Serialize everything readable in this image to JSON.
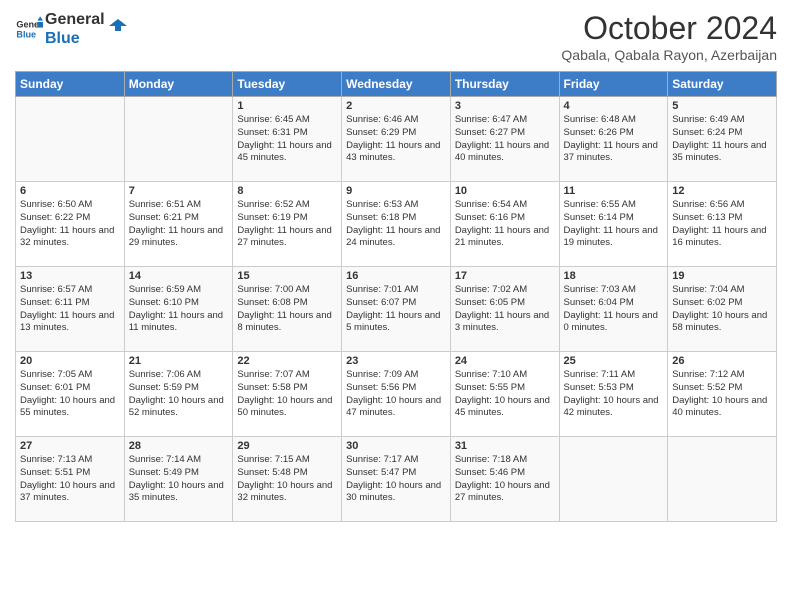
{
  "header": {
    "logo_general": "General",
    "logo_blue": "Blue",
    "month": "October 2024",
    "location": "Qabala, Qabala Rayon, Azerbaijan"
  },
  "days_of_week": [
    "Sunday",
    "Monday",
    "Tuesday",
    "Wednesday",
    "Thursday",
    "Friday",
    "Saturday"
  ],
  "weeks": [
    [
      {
        "day": "",
        "content": ""
      },
      {
        "day": "",
        "content": ""
      },
      {
        "day": "1",
        "content": "Sunrise: 6:45 AM\nSunset: 6:31 PM\nDaylight: 11 hours and 45 minutes."
      },
      {
        "day": "2",
        "content": "Sunrise: 6:46 AM\nSunset: 6:29 PM\nDaylight: 11 hours and 43 minutes."
      },
      {
        "day": "3",
        "content": "Sunrise: 6:47 AM\nSunset: 6:27 PM\nDaylight: 11 hours and 40 minutes."
      },
      {
        "day": "4",
        "content": "Sunrise: 6:48 AM\nSunset: 6:26 PM\nDaylight: 11 hours and 37 minutes."
      },
      {
        "day": "5",
        "content": "Sunrise: 6:49 AM\nSunset: 6:24 PM\nDaylight: 11 hours and 35 minutes."
      }
    ],
    [
      {
        "day": "6",
        "content": "Sunrise: 6:50 AM\nSunset: 6:22 PM\nDaylight: 11 hours and 32 minutes."
      },
      {
        "day": "7",
        "content": "Sunrise: 6:51 AM\nSunset: 6:21 PM\nDaylight: 11 hours and 29 minutes."
      },
      {
        "day": "8",
        "content": "Sunrise: 6:52 AM\nSunset: 6:19 PM\nDaylight: 11 hours and 27 minutes."
      },
      {
        "day": "9",
        "content": "Sunrise: 6:53 AM\nSunset: 6:18 PM\nDaylight: 11 hours and 24 minutes."
      },
      {
        "day": "10",
        "content": "Sunrise: 6:54 AM\nSunset: 6:16 PM\nDaylight: 11 hours and 21 minutes."
      },
      {
        "day": "11",
        "content": "Sunrise: 6:55 AM\nSunset: 6:14 PM\nDaylight: 11 hours and 19 minutes."
      },
      {
        "day": "12",
        "content": "Sunrise: 6:56 AM\nSunset: 6:13 PM\nDaylight: 11 hours and 16 minutes."
      }
    ],
    [
      {
        "day": "13",
        "content": "Sunrise: 6:57 AM\nSunset: 6:11 PM\nDaylight: 11 hours and 13 minutes."
      },
      {
        "day": "14",
        "content": "Sunrise: 6:59 AM\nSunset: 6:10 PM\nDaylight: 11 hours and 11 minutes."
      },
      {
        "day": "15",
        "content": "Sunrise: 7:00 AM\nSunset: 6:08 PM\nDaylight: 11 hours and 8 minutes."
      },
      {
        "day": "16",
        "content": "Sunrise: 7:01 AM\nSunset: 6:07 PM\nDaylight: 11 hours and 5 minutes."
      },
      {
        "day": "17",
        "content": "Sunrise: 7:02 AM\nSunset: 6:05 PM\nDaylight: 11 hours and 3 minutes."
      },
      {
        "day": "18",
        "content": "Sunrise: 7:03 AM\nSunset: 6:04 PM\nDaylight: 11 hours and 0 minutes."
      },
      {
        "day": "19",
        "content": "Sunrise: 7:04 AM\nSunset: 6:02 PM\nDaylight: 10 hours and 58 minutes."
      }
    ],
    [
      {
        "day": "20",
        "content": "Sunrise: 7:05 AM\nSunset: 6:01 PM\nDaylight: 10 hours and 55 minutes."
      },
      {
        "day": "21",
        "content": "Sunrise: 7:06 AM\nSunset: 5:59 PM\nDaylight: 10 hours and 52 minutes."
      },
      {
        "day": "22",
        "content": "Sunrise: 7:07 AM\nSunset: 5:58 PM\nDaylight: 10 hours and 50 minutes."
      },
      {
        "day": "23",
        "content": "Sunrise: 7:09 AM\nSunset: 5:56 PM\nDaylight: 10 hours and 47 minutes."
      },
      {
        "day": "24",
        "content": "Sunrise: 7:10 AM\nSunset: 5:55 PM\nDaylight: 10 hours and 45 minutes."
      },
      {
        "day": "25",
        "content": "Sunrise: 7:11 AM\nSunset: 5:53 PM\nDaylight: 10 hours and 42 minutes."
      },
      {
        "day": "26",
        "content": "Sunrise: 7:12 AM\nSunset: 5:52 PM\nDaylight: 10 hours and 40 minutes."
      }
    ],
    [
      {
        "day": "27",
        "content": "Sunrise: 7:13 AM\nSunset: 5:51 PM\nDaylight: 10 hours and 37 minutes."
      },
      {
        "day": "28",
        "content": "Sunrise: 7:14 AM\nSunset: 5:49 PM\nDaylight: 10 hours and 35 minutes."
      },
      {
        "day": "29",
        "content": "Sunrise: 7:15 AM\nSunset: 5:48 PM\nDaylight: 10 hours and 32 minutes."
      },
      {
        "day": "30",
        "content": "Sunrise: 7:17 AM\nSunset: 5:47 PM\nDaylight: 10 hours and 30 minutes."
      },
      {
        "day": "31",
        "content": "Sunrise: 7:18 AM\nSunset: 5:46 PM\nDaylight: 10 hours and 27 minutes."
      },
      {
        "day": "",
        "content": ""
      },
      {
        "day": "",
        "content": ""
      }
    ]
  ]
}
